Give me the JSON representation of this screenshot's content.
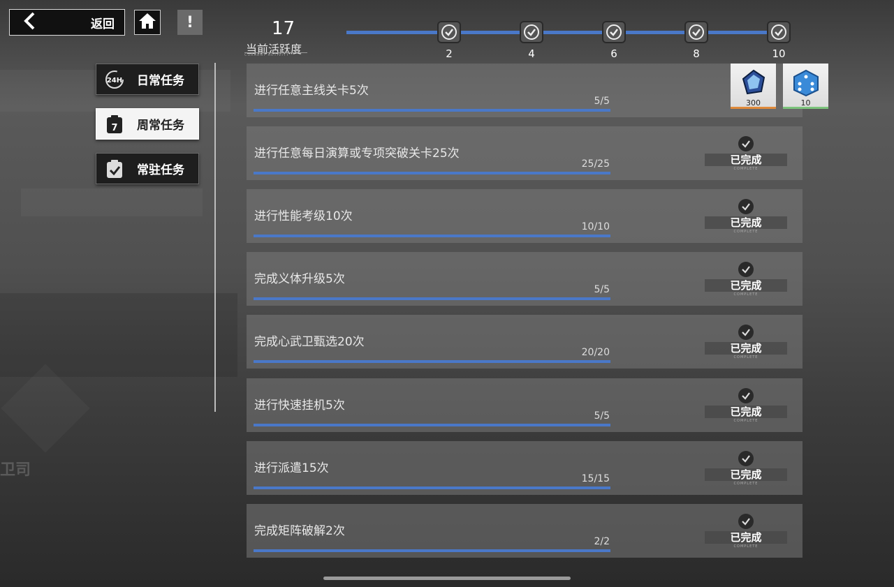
{
  "header": {
    "back_label": "返回",
    "home_icon": "home-icon",
    "alert_label": "!"
  },
  "activity": {
    "value": "17",
    "label": "当前活跃度",
    "sublabel": "CURRENT ACTIVITY",
    "milestones": [
      "2",
      "4",
      "6",
      "8",
      "10"
    ]
  },
  "tabs": [
    {
      "label": "日常任务",
      "icon": "24h-clock-icon",
      "active": false
    },
    {
      "label": "周常任务",
      "icon": "calendar-7-icon",
      "active": true
    },
    {
      "label": "常驻任务",
      "icon": "clipboard-check-icon",
      "active": false
    }
  ],
  "rewards": [
    {
      "icon": "blue-crystal-icon",
      "count": "300",
      "strip_color": "#e08a3a"
    },
    {
      "icon": "blue-dice-icon",
      "count": "10",
      "strip_color": "#7cc47c"
    }
  ],
  "tasks": [
    {
      "title": "进行任意主线关卡5次",
      "progress": "5/5",
      "fraction": 1.0,
      "status": "",
      "status_sub": ""
    },
    {
      "title": "进行任意每日演算或专项突破关卡25次",
      "progress": "25/25",
      "fraction": 1.0,
      "status": "已完成",
      "status_sub": "COMPLETE"
    },
    {
      "title": "进行性能考级10次",
      "progress": "10/10",
      "fraction": 1.0,
      "status": "已完成",
      "status_sub": "COMPLETE"
    },
    {
      "title": "完成义体升级5次",
      "progress": "5/5",
      "fraction": 1.0,
      "status": "已完成",
      "status_sub": "COMPLETE"
    },
    {
      "title": "完成心武卫甄选20次",
      "progress": "20/20",
      "fraction": 1.0,
      "status": "已完成",
      "status_sub": "COMPLETE"
    },
    {
      "title": "进行快速挂机5次",
      "progress": "5/5",
      "fraction": 1.0,
      "status": "已完成",
      "status_sub": "COMPLETE"
    },
    {
      "title": "进行派遣15次",
      "progress": "15/15",
      "fraction": 1.0,
      "status": "已完成",
      "status_sub": "COMPLETE"
    },
    {
      "title": "完成矩阵破解2次",
      "progress": "2/2",
      "fraction": 1.0,
      "status": "已完成",
      "status_sub": "COMPLETE"
    }
  ],
  "watermark": "卫司",
  "colors": {
    "accent": "#4a78c8"
  }
}
